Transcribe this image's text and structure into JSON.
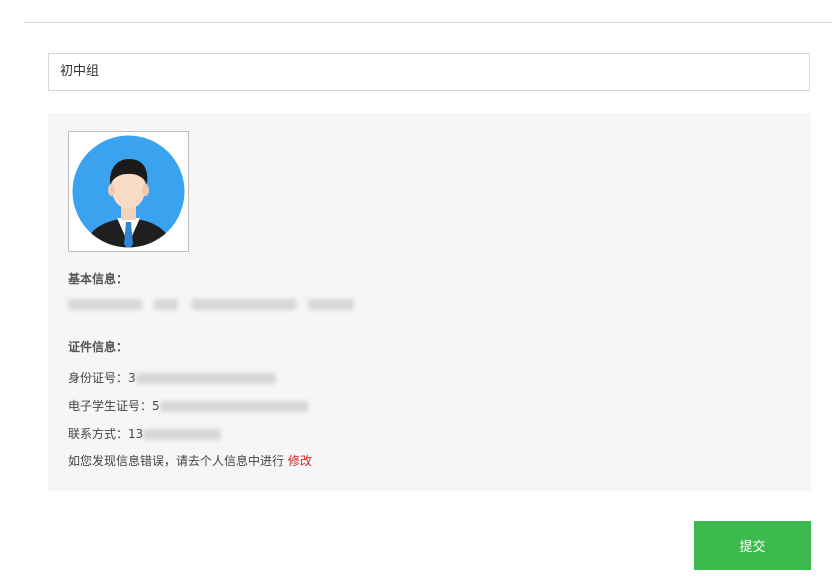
{
  "form": {
    "group_value": "初中组"
  },
  "profile": {
    "basic_info_label": "基本信息：",
    "cert_info_label": "证件信息：",
    "id_card_label": "身份证号：",
    "id_card_visible": "3",
    "student_id_label": "电子学生证号：",
    "student_id_visible": "5",
    "contact_label": "联系方式：",
    "contact_visible": "13",
    "notice_text": "如您发现信息错误，请去个人信息中进行",
    "edit_link": "修改"
  },
  "actions": {
    "submit_label": "提交"
  },
  "colors": {
    "accent_green": "#3dba4e",
    "link_red": "#e02020",
    "avatar_bg": "#3aa3f0",
    "card_bg": "#f5f6f8"
  },
  "icons": {
    "avatar": "user-avatar-illustration"
  }
}
